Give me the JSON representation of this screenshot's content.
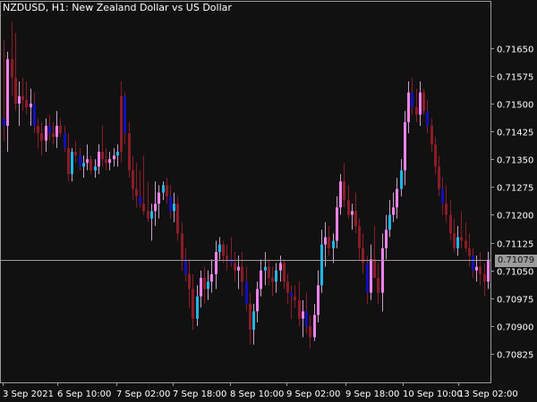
{
  "window": {
    "title": "NZDUSD, H1:  New Zealand Dollar vs US Dollar"
  },
  "chart_data": {
    "type": "candlestick",
    "symbol": "NZDUSD",
    "timeframe": "H1",
    "description": "New Zealand Dollar vs US Dollar",
    "y_ticks": [
      0.7165,
      0.71575,
      0.715,
      0.71425,
      0.7135,
      0.71275,
      0.712,
      0.71125,
      0.7105,
      0.70975,
      0.709,
      0.70825
    ],
    "y_tick_labels": [
      "0.71650",
      "0.71575",
      "0.71500",
      "0.71425",
      "0.71350",
      "0.71275",
      "0.71200",
      "0.71125",
      "0.71050",
      "0.70975",
      "0.70900",
      "0.70825"
    ],
    "ylim": [
      0.70758,
      0.7176
    ],
    "x_labels": [
      "3 Sep 2021",
      "6 Sep 10:00",
      "7 Sep 02:00",
      "7 Sep 18:00",
      "8 Sep 10:00",
      "9 Sep 02:00",
      "9 Sep 18:00",
      "10 Sep 10:00",
      "13 Sep 02:00"
    ],
    "current_price": 0.71079,
    "current_price_label": "0.71079",
    "colors": {
      "background": "#111111",
      "frame": "#9c9c9c",
      "text": "#ffffff",
      "bull_wick": "#c8a0c8",
      "bear_wick": "#8a1c28",
      "bull_body": "#ee82ee",
      "bull_body_alt": "#1fb6e6",
      "bear_body": "#1010b8",
      "bear_body_alt": "#8a1c28",
      "price_line": "#9c9c9c"
    },
    "candles": [
      {
        "o": 0.7146,
        "h": 0.7167,
        "l": 0.714,
        "c": 0.7144,
        "bull": false
      },
      {
        "o": 0.7144,
        "h": 0.7164,
        "l": 0.7137,
        "c": 0.7162,
        "bull": true
      },
      {
        "o": 0.7162,
        "h": 0.7172,
        "l": 0.7152,
        "c": 0.7157,
        "bull": false
      },
      {
        "o": 0.7157,
        "h": 0.7169,
        "l": 0.7148,
        "c": 0.715,
        "bull": false
      },
      {
        "o": 0.715,
        "h": 0.7156,
        "l": 0.7144,
        "c": 0.7152,
        "bull": true
      },
      {
        "o": 0.7152,
        "h": 0.7157,
        "l": 0.7148,
        "c": 0.7151,
        "bull": false
      },
      {
        "o": 0.7151,
        "h": 0.7156,
        "l": 0.7147,
        "c": 0.7149,
        "bull": false
      },
      {
        "o": 0.7149,
        "h": 0.7154,
        "l": 0.7144,
        "c": 0.715,
        "bull": true
      },
      {
        "o": 0.715,
        "h": 0.7153,
        "l": 0.7142,
        "c": 0.7144,
        "bull": false
      },
      {
        "o": 0.7144,
        "h": 0.7146,
        "l": 0.7138,
        "c": 0.7142,
        "bull": false
      },
      {
        "o": 0.7142,
        "h": 0.7145,
        "l": 0.7136,
        "c": 0.714,
        "bull": false
      },
      {
        "o": 0.714,
        "h": 0.7146,
        "l": 0.7137,
        "c": 0.7144,
        "bull": true
      },
      {
        "o": 0.7144,
        "h": 0.7147,
        "l": 0.714,
        "c": 0.7142,
        "bull": false
      },
      {
        "o": 0.7142,
        "h": 0.7145,
        "l": 0.7139,
        "c": 0.7141,
        "bull": false
      },
      {
        "o": 0.7141,
        "h": 0.7148,
        "l": 0.7138,
        "c": 0.7144,
        "bull": true
      },
      {
        "o": 0.7144,
        "h": 0.7146,
        "l": 0.7141,
        "c": 0.7142,
        "bull": false
      },
      {
        "o": 0.7142,
        "h": 0.7144,
        "l": 0.7137,
        "c": 0.7138,
        "bull": false
      },
      {
        "o": 0.7138,
        "h": 0.7142,
        "l": 0.7129,
        "c": 0.7131,
        "bull": false
      },
      {
        "o": 0.7131,
        "h": 0.7138,
        "l": 0.7129,
        "c": 0.7137,
        "bull": true
      },
      {
        "o": 0.7137,
        "h": 0.714,
        "l": 0.7134,
        "c": 0.7136,
        "bull": false
      },
      {
        "o": 0.7136,
        "h": 0.7138,
        "l": 0.7132,
        "c": 0.7133,
        "bull": false
      },
      {
        "o": 0.7133,
        "h": 0.7136,
        "l": 0.713,
        "c": 0.7134,
        "bull": true
      },
      {
        "o": 0.7134,
        "h": 0.7139,
        "l": 0.7132,
        "c": 0.7135,
        "bull": true
      },
      {
        "o": 0.7135,
        "h": 0.7136,
        "l": 0.7131,
        "c": 0.7132,
        "bull": false
      },
      {
        "o": 0.7132,
        "h": 0.7135,
        "l": 0.713,
        "c": 0.7133,
        "bull": true
      },
      {
        "o": 0.7133,
        "h": 0.7139,
        "l": 0.7131,
        "c": 0.7137,
        "bull": true
      },
      {
        "o": 0.7137,
        "h": 0.7144,
        "l": 0.7133,
        "c": 0.7135,
        "bull": false
      },
      {
        "o": 0.7135,
        "h": 0.7138,
        "l": 0.7132,
        "c": 0.7134,
        "bull": false
      },
      {
        "o": 0.7134,
        "h": 0.7137,
        "l": 0.7132,
        "c": 0.7135,
        "bull": true
      },
      {
        "o": 0.7135,
        "h": 0.7138,
        "l": 0.7133,
        "c": 0.7136,
        "bull": true
      },
      {
        "o": 0.7136,
        "h": 0.7139,
        "l": 0.7133,
        "c": 0.7137,
        "bull": true
      },
      {
        "o": 0.7137,
        "h": 0.7156,
        "l": 0.7134,
        "c": 0.7152,
        "bull": false
      },
      {
        "o": 0.7152,
        "h": 0.7153,
        "l": 0.7139,
        "c": 0.7142,
        "bull": false
      },
      {
        "o": 0.7142,
        "h": 0.7145,
        "l": 0.713,
        "c": 0.7132,
        "bull": false
      },
      {
        "o": 0.7132,
        "h": 0.7136,
        "l": 0.7124,
        "c": 0.7127,
        "bull": false
      },
      {
        "o": 0.7127,
        "h": 0.7134,
        "l": 0.7122,
        "c": 0.7125,
        "bull": false
      },
      {
        "o": 0.7125,
        "h": 0.7132,
        "l": 0.7122,
        "c": 0.7123,
        "bull": false
      },
      {
        "o": 0.7123,
        "h": 0.7136,
        "l": 0.712,
        "c": 0.7121,
        "bull": false
      },
      {
        "o": 0.7121,
        "h": 0.7129,
        "l": 0.7118,
        "c": 0.7119,
        "bull": false
      },
      {
        "o": 0.7119,
        "h": 0.7123,
        "l": 0.7113,
        "c": 0.7121,
        "bull": true
      },
      {
        "o": 0.7121,
        "h": 0.7129,
        "l": 0.7117,
        "c": 0.7123,
        "bull": true
      },
      {
        "o": 0.7123,
        "h": 0.7128,
        "l": 0.7119,
        "c": 0.7126,
        "bull": true
      },
      {
        "o": 0.7126,
        "h": 0.7129,
        "l": 0.7124,
        "c": 0.7128,
        "bull": true
      },
      {
        "o": 0.7128,
        "h": 0.713,
        "l": 0.7123,
        "c": 0.7125,
        "bull": false
      },
      {
        "o": 0.7125,
        "h": 0.7128,
        "l": 0.7119,
        "c": 0.7121,
        "bull": false
      },
      {
        "o": 0.7121,
        "h": 0.7126,
        "l": 0.7118,
        "c": 0.7123,
        "bull": true
      },
      {
        "o": 0.7123,
        "h": 0.7125,
        "l": 0.7113,
        "c": 0.7115,
        "bull": false
      },
      {
        "o": 0.7115,
        "h": 0.7118,
        "l": 0.7105,
        "c": 0.7108,
        "bull": false
      },
      {
        "o": 0.7108,
        "h": 0.7111,
        "l": 0.7102,
        "c": 0.7104,
        "bull": false
      },
      {
        "o": 0.7104,
        "h": 0.7108,
        "l": 0.7095,
        "c": 0.71,
        "bull": false
      },
      {
        "o": 0.71,
        "h": 0.7104,
        "l": 0.7089,
        "c": 0.7092,
        "bull": false
      },
      {
        "o": 0.7092,
        "h": 0.7101,
        "l": 0.709,
        "c": 0.7098,
        "bull": true
      },
      {
        "o": 0.7098,
        "h": 0.7105,
        "l": 0.7095,
        "c": 0.7103,
        "bull": true
      },
      {
        "o": 0.7103,
        "h": 0.7106,
        "l": 0.7096,
        "c": 0.71,
        "bull": false
      },
      {
        "o": 0.71,
        "h": 0.7105,
        "l": 0.7097,
        "c": 0.7102,
        "bull": true
      },
      {
        "o": 0.7102,
        "h": 0.7108,
        "l": 0.7099,
        "c": 0.7104,
        "bull": true
      },
      {
        "o": 0.7104,
        "h": 0.7113,
        "l": 0.71,
        "c": 0.711,
        "bull": true
      },
      {
        "o": 0.711,
        "h": 0.7114,
        "l": 0.7108,
        "c": 0.7112,
        "bull": true
      },
      {
        "o": 0.7112,
        "h": 0.7113,
        "l": 0.7107,
        "c": 0.7109,
        "bull": false
      },
      {
        "o": 0.7109,
        "h": 0.7112,
        "l": 0.7105,
        "c": 0.7108,
        "bull": false
      },
      {
        "o": 0.7108,
        "h": 0.7114,
        "l": 0.7106,
        "c": 0.7107,
        "bull": false
      },
      {
        "o": 0.7107,
        "h": 0.711,
        "l": 0.7102,
        "c": 0.7105,
        "bull": false
      },
      {
        "o": 0.7105,
        "h": 0.7109,
        "l": 0.71,
        "c": 0.7106,
        "bull": true
      },
      {
        "o": 0.7106,
        "h": 0.711,
        "l": 0.7098,
        "c": 0.7102,
        "bull": false
      },
      {
        "o": 0.7102,
        "h": 0.7106,
        "l": 0.7094,
        "c": 0.7096,
        "bull": false
      },
      {
        "o": 0.7096,
        "h": 0.7099,
        "l": 0.7085,
        "c": 0.7089,
        "bull": false
      },
      {
        "o": 0.7089,
        "h": 0.7096,
        "l": 0.7085,
        "c": 0.7094,
        "bull": true
      },
      {
        "o": 0.7094,
        "h": 0.7102,
        "l": 0.7091,
        "c": 0.71,
        "bull": true
      },
      {
        "o": 0.71,
        "h": 0.7108,
        "l": 0.7098,
        "c": 0.7105,
        "bull": true
      },
      {
        "o": 0.7105,
        "h": 0.711,
        "l": 0.7101,
        "c": 0.7106,
        "bull": true
      },
      {
        "o": 0.7106,
        "h": 0.7108,
        "l": 0.7101,
        "c": 0.7103,
        "bull": false
      },
      {
        "o": 0.7103,
        "h": 0.7106,
        "l": 0.7098,
        "c": 0.7102,
        "bull": false
      },
      {
        "o": 0.7102,
        "h": 0.7107,
        "l": 0.7099,
        "c": 0.7105,
        "bull": true
      },
      {
        "o": 0.7105,
        "h": 0.7109,
        "l": 0.7102,
        "c": 0.7107,
        "bull": true
      },
      {
        "o": 0.7107,
        "h": 0.7108,
        "l": 0.71,
        "c": 0.7102,
        "bull": false
      },
      {
        "o": 0.7102,
        "h": 0.7104,
        "l": 0.7096,
        "c": 0.7099,
        "bull": false
      },
      {
        "o": 0.7099,
        "h": 0.7101,
        "l": 0.7092,
        "c": 0.7098,
        "bull": false
      },
      {
        "o": 0.7098,
        "h": 0.7101,
        "l": 0.7095,
        "c": 0.7097,
        "bull": false
      },
      {
        "o": 0.7097,
        "h": 0.7102,
        "l": 0.709,
        "c": 0.7092,
        "bull": false
      },
      {
        "o": 0.7092,
        "h": 0.7097,
        "l": 0.7087,
        "c": 0.7094,
        "bull": true
      },
      {
        "o": 0.7094,
        "h": 0.7099,
        "l": 0.7088,
        "c": 0.709,
        "bull": false
      },
      {
        "o": 0.709,
        "h": 0.7093,
        "l": 0.7084,
        "c": 0.7087,
        "bull": false
      },
      {
        "o": 0.7087,
        "h": 0.7096,
        "l": 0.7086,
        "c": 0.7093,
        "bull": true
      },
      {
        "o": 0.7093,
        "h": 0.7105,
        "l": 0.7091,
        "c": 0.7101,
        "bull": true
      },
      {
        "o": 0.7101,
        "h": 0.7116,
        "l": 0.7099,
        "c": 0.7112,
        "bull": true
      },
      {
        "o": 0.7112,
        "h": 0.7118,
        "l": 0.7106,
        "c": 0.7114,
        "bull": true
      },
      {
        "o": 0.7114,
        "h": 0.7117,
        "l": 0.7109,
        "c": 0.7111,
        "bull": false
      },
      {
        "o": 0.7111,
        "h": 0.7115,
        "l": 0.7107,
        "c": 0.7113,
        "bull": true
      },
      {
        "o": 0.7113,
        "h": 0.7125,
        "l": 0.7111,
        "c": 0.7122,
        "bull": true
      },
      {
        "o": 0.7122,
        "h": 0.7131,
        "l": 0.712,
        "c": 0.7129,
        "bull": true
      },
      {
        "o": 0.7129,
        "h": 0.7134,
        "l": 0.7122,
        "c": 0.7124,
        "bull": false
      },
      {
        "o": 0.7124,
        "h": 0.7128,
        "l": 0.7119,
        "c": 0.712,
        "bull": false
      },
      {
        "o": 0.712,
        "h": 0.7123,
        "l": 0.7116,
        "c": 0.7121,
        "bull": true
      },
      {
        "o": 0.7121,
        "h": 0.7126,
        "l": 0.7115,
        "c": 0.7117,
        "bull": false
      },
      {
        "o": 0.7117,
        "h": 0.7119,
        "l": 0.7108,
        "c": 0.7111,
        "bull": false
      },
      {
        "o": 0.7111,
        "h": 0.7115,
        "l": 0.7104,
        "c": 0.7107,
        "bull": false
      },
      {
        "o": 0.7107,
        "h": 0.7109,
        "l": 0.7096,
        "c": 0.7099,
        "bull": false
      },
      {
        "o": 0.7099,
        "h": 0.7112,
        "l": 0.7097,
        "c": 0.7108,
        "bull": true
      },
      {
        "o": 0.7108,
        "h": 0.7117,
        "l": 0.7104,
        "c": 0.7103,
        "bull": false
      },
      {
        "o": 0.7103,
        "h": 0.7107,
        "l": 0.7096,
        "c": 0.7099,
        "bull": false
      },
      {
        "o": 0.7099,
        "h": 0.7115,
        "l": 0.7094,
        "c": 0.7111,
        "bull": true
      },
      {
        "o": 0.7111,
        "h": 0.712,
        "l": 0.7108,
        "c": 0.7116,
        "bull": true
      },
      {
        "o": 0.7116,
        "h": 0.7124,
        "l": 0.7114,
        "c": 0.712,
        "bull": true
      },
      {
        "o": 0.712,
        "h": 0.7126,
        "l": 0.7118,
        "c": 0.7122,
        "bull": true
      },
      {
        "o": 0.7122,
        "h": 0.713,
        "l": 0.7119,
        "c": 0.7127,
        "bull": true
      },
      {
        "o": 0.7127,
        "h": 0.7135,
        "l": 0.7125,
        "c": 0.7132,
        "bull": true
      },
      {
        "o": 0.7132,
        "h": 0.7148,
        "l": 0.7128,
        "c": 0.7145,
        "bull": true
      },
      {
        "o": 0.7145,
        "h": 0.7156,
        "l": 0.7142,
        "c": 0.7153,
        "bull": true
      },
      {
        "o": 0.7153,
        "h": 0.7157,
        "l": 0.7147,
        "c": 0.7149,
        "bull": false
      },
      {
        "o": 0.7149,
        "h": 0.7154,
        "l": 0.7145,
        "c": 0.7147,
        "bull": false
      },
      {
        "o": 0.7147,
        "h": 0.7156,
        "l": 0.7144,
        "c": 0.7153,
        "bull": true
      },
      {
        "o": 0.7153,
        "h": 0.7154,
        "l": 0.7147,
        "c": 0.7148,
        "bull": false
      },
      {
        "o": 0.7148,
        "h": 0.7151,
        "l": 0.7142,
        "c": 0.7144,
        "bull": false
      },
      {
        "o": 0.7144,
        "h": 0.7146,
        "l": 0.7137,
        "c": 0.7139,
        "bull": false
      },
      {
        "o": 0.7139,
        "h": 0.7141,
        "l": 0.7131,
        "c": 0.7133,
        "bull": false
      },
      {
        "o": 0.7133,
        "h": 0.7136,
        "l": 0.7125,
        "c": 0.7127,
        "bull": false
      },
      {
        "o": 0.7127,
        "h": 0.713,
        "l": 0.712,
        "c": 0.7123,
        "bull": false
      },
      {
        "o": 0.7123,
        "h": 0.7128,
        "l": 0.7118,
        "c": 0.712,
        "bull": false
      },
      {
        "o": 0.712,
        "h": 0.7124,
        "l": 0.7113,
        "c": 0.7115,
        "bull": false
      },
      {
        "o": 0.7115,
        "h": 0.7119,
        "l": 0.711,
        "c": 0.7111,
        "bull": false
      },
      {
        "o": 0.7111,
        "h": 0.7117,
        "l": 0.7109,
        "c": 0.7114,
        "bull": true
      },
      {
        "o": 0.7114,
        "h": 0.7121,
        "l": 0.7111,
        "c": 0.7113,
        "bull": false
      },
      {
        "o": 0.7113,
        "h": 0.7118,
        "l": 0.711,
        "c": 0.7111,
        "bull": false
      },
      {
        "o": 0.7111,
        "h": 0.7115,
        "l": 0.7106,
        "c": 0.7109,
        "bull": false
      },
      {
        "o": 0.7109,
        "h": 0.7111,
        "l": 0.7103,
        "c": 0.7105,
        "bull": false
      },
      {
        "o": 0.7105,
        "h": 0.7109,
        "l": 0.7102,
        "c": 0.7106,
        "bull": true
      },
      {
        "o": 0.7106,
        "h": 0.711,
        "l": 0.7101,
        "c": 0.7104,
        "bull": false
      },
      {
        "o": 0.7104,
        "h": 0.7107,
        "l": 0.7098,
        "c": 0.7102,
        "bull": false
      },
      {
        "o": 0.7102,
        "h": 0.711,
        "l": 0.71,
        "c": 0.71079,
        "bull": true
      }
    ]
  }
}
